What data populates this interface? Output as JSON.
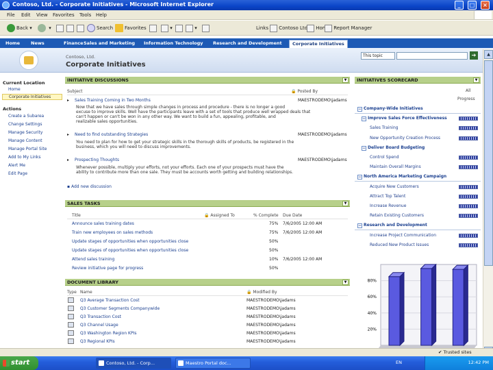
{
  "window": {
    "title": "Contoso, Ltd. - Corporate Initiatives - Microsoft Internet Explorer",
    "min": "_",
    "max": "□",
    "close": "×"
  },
  "menu": [
    "File",
    "Edit",
    "View",
    "Favorites",
    "Tools",
    "Help"
  ],
  "toolbar": {
    "back": "Back",
    "search": "Search",
    "favorites": "Favorites",
    "links_label": "Links",
    "links": [
      "Contoso Ltd.",
      "Home",
      "Report Manager"
    ]
  },
  "topnav": {
    "tabs": [
      "Home",
      "News",
      "Finance",
      "Sales and Marketing",
      "Information Technology",
      "Research and Development",
      "Corporate Initiatives"
    ],
    "active": "Corporate Initiatives"
  },
  "header": {
    "breadcrumb": "Contoso, Ltd.",
    "title": "Corporate Initiatives",
    "search_scope": "This topic",
    "search_go": "➔"
  },
  "leftnav": {
    "current_location_heading": "Current Location",
    "locations": [
      "Home",
      "Corporate Initiatives"
    ],
    "actions_heading": "Actions",
    "actions": [
      "Create a Subarea",
      "Change Settings",
      "Manage Security",
      "Manage Content",
      "Manage Portal Site",
      "Add to My Links",
      "Alert Me",
      "Edit Page"
    ]
  },
  "discussions": {
    "title": "INITIATIVE DISCUSSIONS",
    "col_subject": "Subject",
    "col_posted": "Posted By",
    "items": [
      {
        "subject": "Sales Training Coming in Two Months",
        "posted_by": "MAESTRODEMO\\jadams",
        "lines": [
          "Now that we have sales through simple changes in process and procedure - there is no longer a good",
          "excuse to improve skills. Well have the participants leave with a set of tools that produce well wrapped deals that",
          "can't happen or can't be won in any other way. We want to build a fun, appealing, profitable, and",
          "realizable sales opportunities."
        ]
      },
      {
        "subject": "Need to find outstanding Strategies",
        "posted_by": "MAESTRODEMO\\jadams",
        "lines": [
          "You need to plan for how to get your strategic skills in the thorough skills of products, be registered in the",
          "business, which you will need to discuss improvements."
        ]
      },
      {
        "subject": "Prospecting Thoughts",
        "posted_by": "MAESTRODEMO\\jadams",
        "lines": [
          "Whenever possible, multiply your efforts, not your efforts. Each one of your prospects must have the",
          "ability to contribute more than one sale. They must be accounts worth getting and building relationships."
        ]
      }
    ],
    "add_link": "Add new discussion"
  },
  "sales_tasks": {
    "title": "SALES TASKS",
    "col_title": "Title",
    "col_assigned": "Assigned To",
    "col_complete": "% Complete",
    "col_due": "Due Date",
    "rows": [
      {
        "title": "Announce sales training dates",
        "complete": "75%",
        "due": "7/6/2005 12:00 AM"
      },
      {
        "title": "Train new employees on sales methods",
        "complete": "75%",
        "due": "7/6/2005 12:00 AM"
      },
      {
        "title": "Update stages of opportunities when opportunities close",
        "complete": "50%",
        "due": ""
      },
      {
        "title": "Update stages of opportunities when opportunities close",
        "complete": "50%",
        "due": ""
      },
      {
        "title": "Attend sales training",
        "complete": "10%",
        "due": "7/6/2005 12:00 AM"
      },
      {
        "title": "Review initiative page for progress",
        "complete": "50%",
        "due": ""
      }
    ]
  },
  "docs": {
    "title": "DOCUMENT LIBRARY",
    "col_type": "Type",
    "col_name": "Name",
    "col_modified": "Modified By",
    "rows": [
      {
        "name": "Q3 Average Transaction Cost",
        "modified": "MAESTRODEMO\\jadams"
      },
      {
        "name": "Q3 Customer Segments Companywide",
        "modified": "MAESTRODEMO\\jadams"
      },
      {
        "name": "Q3 Transaction Cost",
        "modified": "MAESTRODEMO\\jadams"
      },
      {
        "name": "Q3 Channel Usage",
        "modified": "MAESTRODEMO\\jadams"
      },
      {
        "name": "Q3 Washington Region KPIs",
        "modified": "MAESTRODEMO\\jadams"
      },
      {
        "name": "Q3 Regional KPIs",
        "modified": "MAESTRODEMO\\jadams"
      }
    ]
  },
  "scorecard": {
    "title": "INITIATIVES SCORECARD",
    "col_all": "All",
    "col_progress": "Progress",
    "rows": [
      {
        "label": "Company-Wide Initiatives",
        "level": 0,
        "toggle": "−",
        "bar": false
      },
      {
        "label": "Improve Sales Force Effectiveness",
        "level": 1,
        "toggle": "−",
        "bar": true
      },
      {
        "label": "Sales Training",
        "level": 2,
        "toggle": "",
        "bar": true
      },
      {
        "label": "New Opportunity Creation Process",
        "level": 2,
        "toggle": "",
        "bar": true
      },
      {
        "label": "Deliver Board Budgeting",
        "level": 1,
        "toggle": "−",
        "bar": false
      },
      {
        "label": "Control Spend",
        "level": 2,
        "toggle": "",
        "bar": true
      },
      {
        "label": "Maintain Overall Margins",
        "level": 2,
        "toggle": "",
        "bar": true
      },
      {
        "label": "North America Marketing Campaign",
        "level": 0,
        "toggle": "−",
        "bar": false
      },
      {
        "label": "Acquire New Customers",
        "level": 2,
        "toggle": "",
        "bar": true
      },
      {
        "label": "Attract Top Talent",
        "level": 2,
        "toggle": "",
        "bar": true
      },
      {
        "label": "Increase Revenue",
        "level": 2,
        "toggle": "",
        "bar": true
      },
      {
        "label": "Retain Existing Customers",
        "level": 2,
        "toggle": "",
        "bar": true
      },
      {
        "label": "Research and Development",
        "level": 0,
        "toggle": "−",
        "bar": false
      },
      {
        "label": "Increase Project Communication",
        "level": 2,
        "toggle": "",
        "bar": true
      },
      {
        "label": "Reduced New Product Issues",
        "level": 2,
        "toggle": "",
        "bar": true
      }
    ]
  },
  "chart_data": {
    "type": "bar",
    "categories": [
      "",
      "",
      ""
    ],
    "values": [
      85,
      95,
      94
    ],
    "yticks": [
      "80%",
      "60%",
      "40%",
      "20%"
    ],
    "ylim": [
      0,
      100
    ],
    "bar_color": "#5a5ae0"
  },
  "statusbar": {
    "zone": "Trusted sites"
  },
  "taskbar": {
    "start": "start",
    "items": [
      "Contoso, Ltd. - Corp...",
      "Maestro Portal doc..."
    ],
    "lang": "EN",
    "clock": "12:42 PM"
  }
}
